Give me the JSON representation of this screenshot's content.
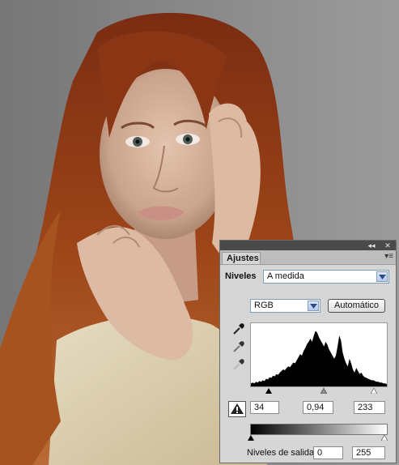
{
  "panel": {
    "tab_label": "Ajustes",
    "collapse_glyph": "◂◂",
    "close_glyph": "✕",
    "menu_glyph": "▾≡",
    "adjustment_label": "Niveles",
    "preset_value": "A medida",
    "channel_value": "RGB",
    "auto_button": "Automático",
    "input_levels": {
      "black": "34",
      "gamma": "0,94",
      "white": "233"
    },
    "output_label": "Niveles de salida:",
    "output_levels": {
      "black": "0",
      "white": "255"
    },
    "icons": [
      "black-eyedropper-icon",
      "gray-eyedropper-icon",
      "white-eyedropper-icon",
      "clipping-warning-icon"
    ]
  },
  "histogram": {
    "channel": "RGB",
    "values": [
      4,
      5,
      4,
      6,
      5,
      7,
      6,
      8,
      7,
      10,
      9,
      12,
      11,
      14,
      13,
      16,
      15,
      18,
      20,
      22,
      21,
      24,
      26,
      25,
      28,
      31,
      30,
      34,
      38,
      42,
      40,
      46,
      50,
      55,
      58,
      62,
      58,
      66,
      72,
      70,
      64,
      60,
      56,
      52,
      58,
      54,
      48,
      44,
      40,
      36,
      40,
      52,
      66,
      60,
      44,
      36,
      30,
      26,
      36,
      30,
      22,
      18,
      24,
      20,
      16,
      18,
      14,
      12,
      11,
      10,
      9,
      8,
      8,
      7,
      6,
      6,
      5,
      5,
      4,
      4,
      3
    ]
  }
}
